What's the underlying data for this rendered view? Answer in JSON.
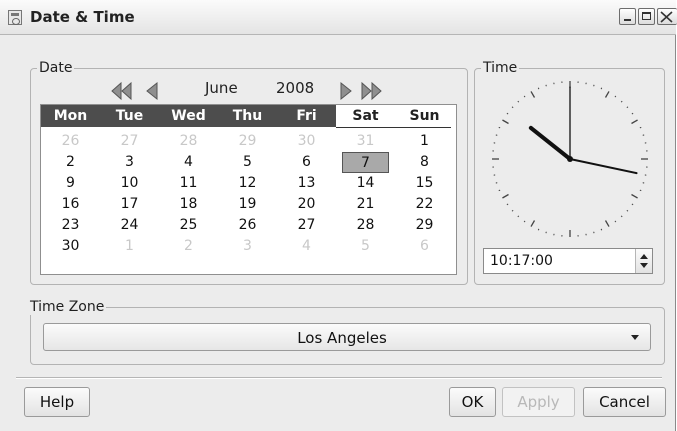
{
  "window": {
    "title": "Date & Time"
  },
  "date_group": {
    "legend": "Date",
    "month": "June",
    "year": "2008",
    "weekdays": [
      "Mon",
      "Tue",
      "Wed",
      "Thu",
      "Fri",
      "Sat",
      "Sun"
    ],
    "weeks": [
      [
        "26",
        "27",
        "28",
        "29",
        "30",
        "31",
        "1"
      ],
      [
        "2",
        "3",
        "4",
        "5",
        "6",
        "7",
        "8"
      ],
      [
        "9",
        "10",
        "11",
        "12",
        "13",
        "14",
        "15"
      ],
      [
        "16",
        "17",
        "18",
        "19",
        "20",
        "21",
        "22"
      ],
      [
        "23",
        "24",
        "25",
        "26",
        "27",
        "28",
        "29"
      ],
      [
        "30",
        "1",
        "2",
        "3",
        "4",
        "5",
        "6"
      ]
    ],
    "selected_day": "7"
  },
  "time_group": {
    "legend": "Time",
    "time_value": "10:17:00"
  },
  "timezone_group": {
    "legend": "Time Zone",
    "selected": "Los Angeles"
  },
  "buttons": {
    "help": "Help",
    "ok": "OK",
    "apply": "Apply",
    "cancel": "Cancel"
  },
  "colors": {
    "header_weekday_bg": "#4d4d4d",
    "header_weekend_bg": "#ffffff",
    "selected_bg": "#a9a9a9"
  }
}
